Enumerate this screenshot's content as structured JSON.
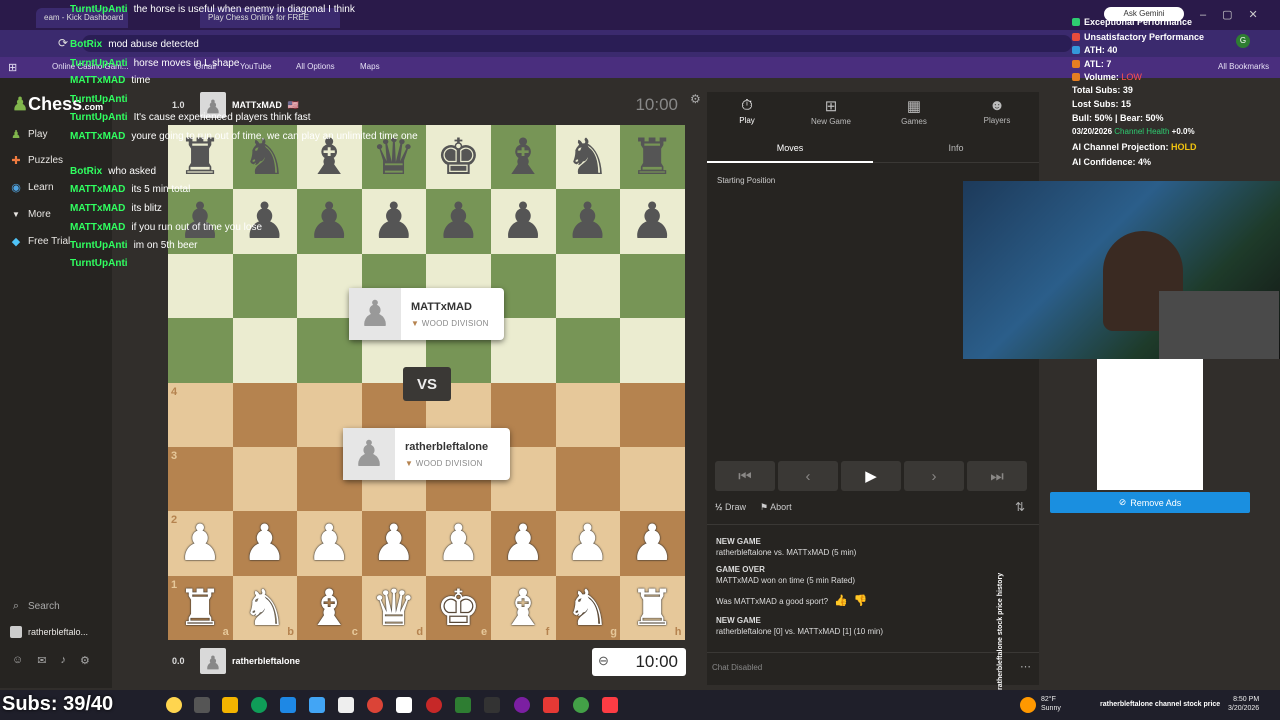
{
  "browser": {
    "tabs": [
      "eam - Kick Dashboard",
      "Play Chess Online for FREE"
    ],
    "bookmarks": [
      "Online Casino Gam...",
      "Gmail",
      "YouTube",
      "All Options",
      "Maps"
    ],
    "all_bookmarks": "All Bookmarks"
  },
  "sidebar": {
    "logo": "Chess",
    "logo_suffix": ".com",
    "items": [
      {
        "label": "Play",
        "icon": "pawn-icon"
      },
      {
        "label": "Puzzles",
        "icon": "puzzle-icon"
      },
      {
        "label": "Learn",
        "icon": "learn-icon"
      },
      {
        "label": "More",
        "icon": "chevron-down-icon"
      },
      {
        "label": "Free Trial",
        "icon": "diamond-icon"
      }
    ],
    "search": "Search",
    "user": "ratherbleftalo..."
  },
  "game": {
    "top_player": {
      "name": "MATTxMAD",
      "rating": "1.0",
      "flag": "🇺🇸"
    },
    "bottom_player": {
      "name": "ratherbleftalone",
      "rating": "0.0"
    },
    "top_clock": "10:00",
    "bottom_clock": "10:00",
    "vs_label": "VS",
    "card_top": {
      "name": "MATTxMAD",
      "division": "WOOD DIVISION"
    },
    "card_bottom": {
      "name": "ratherbleftalone",
      "division": "WOOD DIVISION"
    },
    "ranks": [
      "4",
      "3",
      "2",
      "1"
    ],
    "files": [
      "a",
      "b",
      "c",
      "d",
      "e",
      "f",
      "g",
      "h"
    ]
  },
  "panel": {
    "tabs": [
      {
        "label": "Play",
        "icon": "stopwatch-icon"
      },
      {
        "label": "New Game",
        "icon": "plus-icon"
      },
      {
        "label": "Games",
        "icon": "board-icon"
      },
      {
        "label": "Players",
        "icon": "players-icon"
      }
    ],
    "subtabs": [
      "Moves",
      "Info"
    ],
    "starting_position": "Starting Position",
    "draw": "Draw",
    "abort": "Abort",
    "history": [
      {
        "title": "NEW GAME",
        "text": "ratherbleftalone vs. MATTxMAD (5 min)"
      },
      {
        "title": "GAME OVER",
        "text": "MATTxMAD won on time (5 min Rated)"
      },
      {
        "title": "",
        "text": "Was MATTxMAD a good sport?"
      },
      {
        "title": "NEW GAME",
        "text": "ratherbleftalone [0] vs. MATTxMAD [1] (10 min)"
      }
    ],
    "chat_disabled": "Chat Disabled"
  },
  "chat": [
    {
      "user": "TurntUpAnti",
      "msg": "the horse is useful when enemy in diagonal I think"
    },
    {
      "user": "BotRix",
      "msg": "mod abuse detected"
    },
    {
      "user": "TurntUpAnti",
      "msg": "horse moves in L shape"
    },
    {
      "user": "MATTxMAD",
      "msg": "time"
    },
    {
      "user": "TurntUpAnti",
      "msg": ""
    },
    {
      "user": "TurntUpAnti",
      "msg": "It's cause experienced players think fast"
    },
    {
      "user": "MATTxMAD",
      "msg": "youre going to run out of time, we can play an unlimited time one"
    },
    {
      "user": "BotRix",
      "msg": "who asked"
    },
    {
      "user": "MATTxMAD",
      "msg": "its 5 min total"
    },
    {
      "user": "MATTxMAD",
      "msg": "its blitz"
    },
    {
      "user": "MATTxMAD",
      "msg": "if you run out of time you lose"
    },
    {
      "user": "TurntUpAnti",
      "msg": "im on 5th beer"
    },
    {
      "user": "TurntUpAnti",
      "msg": ""
    }
  ],
  "stats": {
    "ask": "Ask Gemini",
    "exceptional": "Exceptional Performance",
    "unsatisfactory": "Unsatisfactory Performance",
    "ath": "ATH: 40",
    "atl": "ATL: 7",
    "volume_label": "Volume:",
    "volume_value": "LOW",
    "total_subs": "Total Subs: 39",
    "lost_subs": "Lost Subs: 15",
    "bull_bear": "Bull: 50% | Bear: 50%",
    "health_date": "03/20/2026",
    "health_label": "Channel Health",
    "health_value": "+0.0%",
    "projection_label": "AI Channel Projection:",
    "projection_value": "HOLD",
    "confidence": "AI Confidence: 4%"
  },
  "remove_ads": "Remove Ads",
  "stock_history": "ratherbleftalone stock price history",
  "subs_overlay": "Subs: 39/40",
  "taskbar": {
    "weather_temp": "82°F",
    "weather_desc": "Sunny",
    "ticker": "ratherbleftalone channel stock price",
    "time": "8:50 PM",
    "date": "3/20/2026"
  },
  "colors": {
    "accent": "#81b64c",
    "chat_user": "#30ff60",
    "remove_ads": "#1a8fe0"
  }
}
